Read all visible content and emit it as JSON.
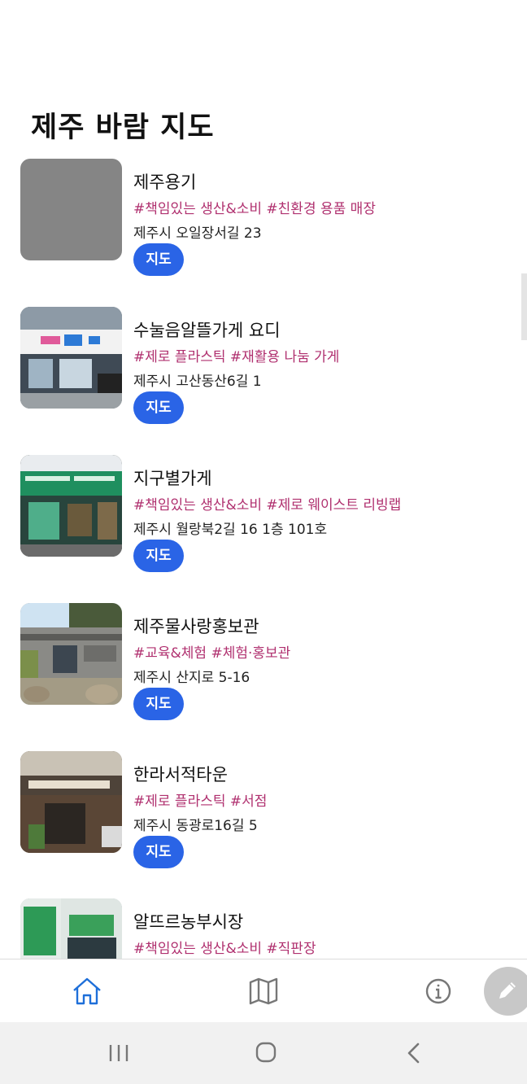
{
  "header": {
    "title": "제주 바람 지도"
  },
  "map_button_label": "지도",
  "places": [
    {
      "name": "제주용기",
      "tags": "#책임있는 생산&소비 #친환경 용품 매장",
      "address": "제주시  오일장서길 23",
      "thumbnail": "placeholder-gray"
    },
    {
      "name": "수눌음알뜰가게 요디",
      "tags": "#제로 플라스틱 #재활용 나눔 가게",
      "address": "제주시  고산동산6길 1",
      "thumbnail": "storefront-photo"
    },
    {
      "name": "지구별가게",
      "tags": "#책임있는 생산&소비 #제로 웨이스트 리빙랩",
      "address": "제주시 월랑북2길 16 1층 101호",
      "thumbnail": "storefront-photo"
    },
    {
      "name": "제주물사랑홍보관",
      "tags": "#교육&체험 #체험·홍보관",
      "address": "제주시 산지로 5-16",
      "thumbnail": "building-photo"
    },
    {
      "name": "한라서적타운",
      "tags": "#제로 플라스틱 #서점",
      "address": "제주시  동광로16길 5",
      "thumbnail": "bookstore-photo"
    },
    {
      "name": "알뜨르농부시장",
      "tags": "#책임있는 생산&소비 #직판장",
      "address": "",
      "thumbnail": "market-photo"
    }
  ],
  "bottom_nav": {
    "items": [
      "home-icon",
      "map-icon",
      "info-icon"
    ],
    "active": "home-icon",
    "active_color": "#1e6fd9"
  },
  "fab": {
    "icon": "pencil-icon"
  },
  "system_nav": {
    "items": [
      "recent-apps-icon",
      "home-circle-icon",
      "back-icon"
    ]
  },
  "colors": {
    "tag": "#b0306f",
    "button": "#2a64e6"
  }
}
